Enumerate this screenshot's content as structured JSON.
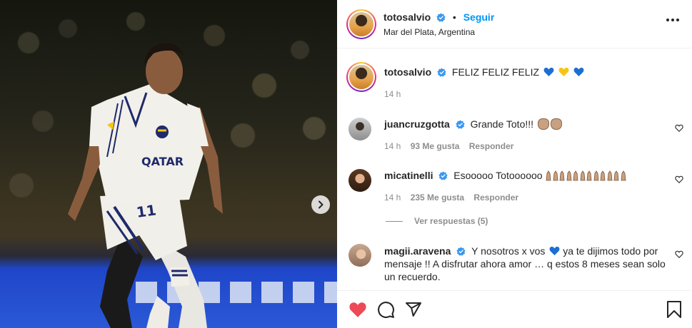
{
  "post": {
    "username": "totosalvio",
    "follow_label": "Seguir",
    "location": "Mar del Plata, Argentina",
    "caption_text": "FELIZ FELIZ FELIZ",
    "caption_time": "14 h"
  },
  "comments": [
    {
      "username": "juancruzgotta",
      "text": "Grande Toto!!!",
      "time": "14 h",
      "likes": "93 Me gusta",
      "reply_label": "Responder"
    },
    {
      "username": "micatinelli",
      "text": "Esooooo Totoooooo",
      "time": "14 h",
      "likes": "235 Me gusta",
      "reply_label": "Responder",
      "view_replies": "Ver respuestas (5)"
    },
    {
      "username": "magii.aravena",
      "text_part1": "Y nosotros x vos",
      "text_part2": "ya te dijimos todo por",
      "text_line2": "mensaje !! A disfrutar ahora amor … q estos 8 meses sean solo",
      "text_line3": "un recuerdo."
    }
  ],
  "icons": {
    "verified": "verified-badge-icon",
    "heart": "heart-icon",
    "comment": "comment-icon",
    "share": "share-icon",
    "save": "bookmark-icon",
    "more": "more-options-icon",
    "next": "chevron-right-icon"
  },
  "colors": {
    "link_blue": "#0095f6",
    "liked_red": "#ed4956",
    "verified_blue": "#3897f0",
    "meta_gray": "#8e8e8e"
  },
  "like_state": "liked"
}
